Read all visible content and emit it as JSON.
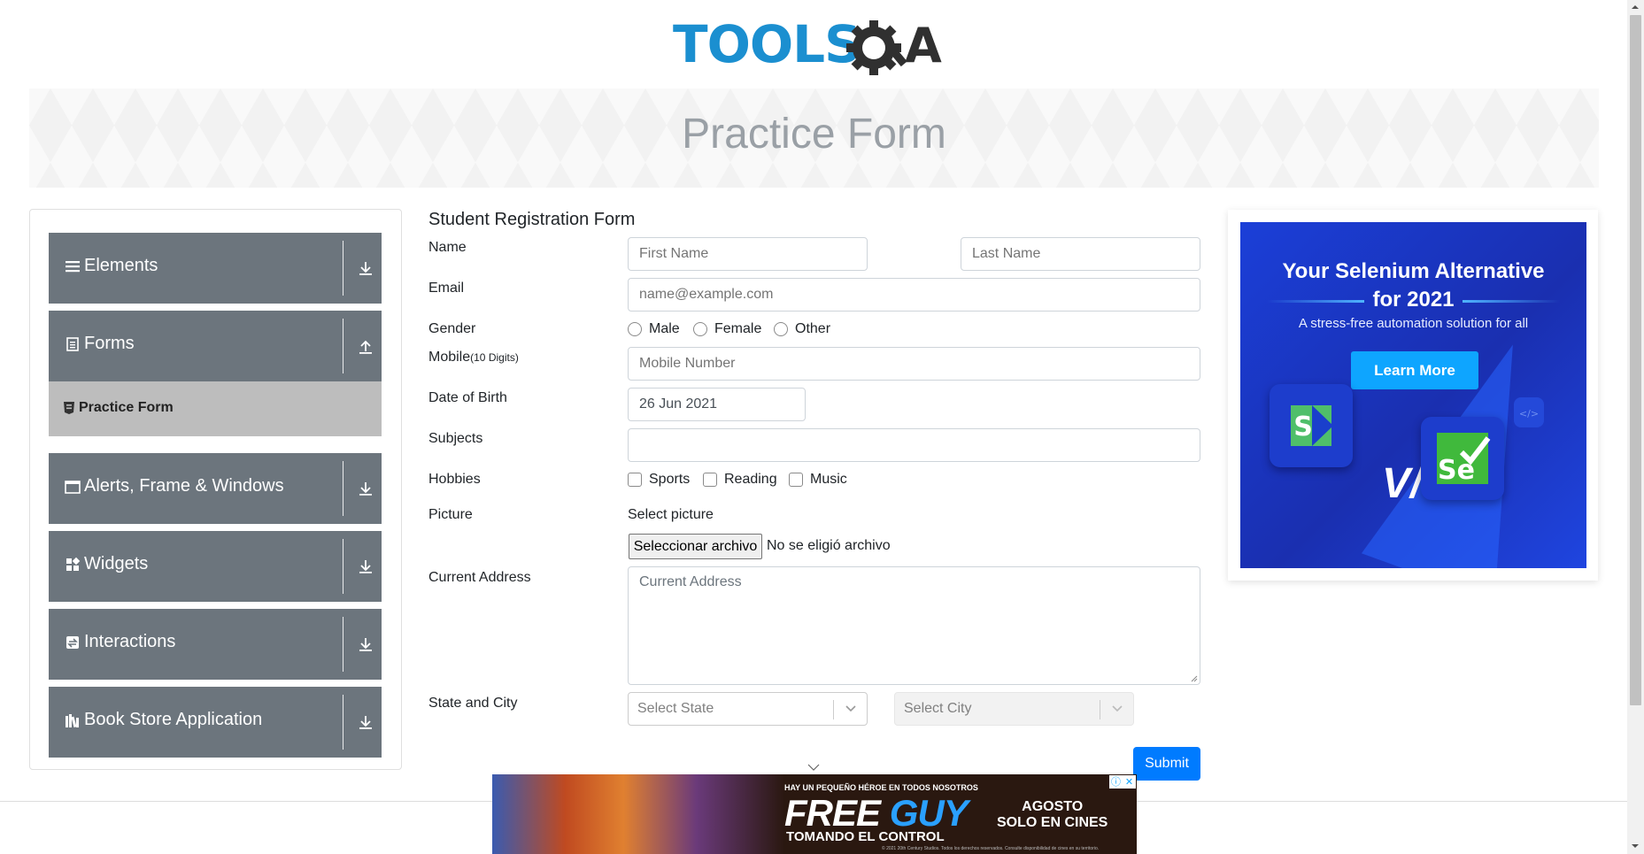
{
  "brand": {
    "logo_text_tools": "TOOLS",
    "logo_text_qa": "QA",
    "blue": "#1b8fd0",
    "dark": "#303030"
  },
  "banner": {
    "title": "Practice Form"
  },
  "sidebar": {
    "groups": [
      {
        "label": "Elements",
        "icon": "menu-icon",
        "arrow": "download-arrow"
      },
      {
        "label": "Forms",
        "icon": "document-icon",
        "arrow": "upload-arrow"
      },
      {
        "label": "Alerts, Frame & Windows",
        "icon": "window-icon",
        "arrow": "download-arrow"
      },
      {
        "label": "Widgets",
        "icon": "widgets-icon",
        "arrow": "download-arrow"
      },
      {
        "label": "Interactions",
        "icon": "interactions-icon",
        "arrow": "download-arrow"
      },
      {
        "label": "Book Store Application",
        "icon": "books-icon",
        "arrow": "download-arrow"
      }
    ],
    "sub_item": {
      "label": "Practice Form",
      "icon": "html-icon"
    },
    "group_color": "#6c757d",
    "sub_item_color": "#bdbdbd"
  },
  "form": {
    "title": "Student Registration Form",
    "labels": {
      "name": "Name",
      "email": "Email",
      "gender": "Gender",
      "mobile": "Mobile",
      "mobile_hint": "(10 Digits)",
      "dob": "Date of Birth",
      "subjects": "Subjects",
      "hobbies": "Hobbies",
      "picture": "Picture",
      "address": "Current Address",
      "state_city": "State and City"
    },
    "placeholders": {
      "first_name": "First Name",
      "last_name": "Last Name",
      "email": "name@example.com",
      "mobile": "Mobile Number",
      "address": "Current Address"
    },
    "values": {
      "dob": "26 Jun 2021",
      "subjects": ""
    },
    "gender_options": [
      "Male",
      "Female",
      "Other"
    ],
    "hobby_options": [
      "Sports",
      "Reading",
      "Music"
    ],
    "picture_hint": "Select picture",
    "file_button": "Seleccionar archivo",
    "file_status": "No se eligió archivo",
    "state_placeholder": "Select State",
    "city_placeholder": "Select City",
    "submit": "Submit",
    "submit_color": "#007bff"
  },
  "ad_right": {
    "title_line1": "Your Selenium Alternative",
    "title_line2": "for 2021",
    "subtitle": "A stress-free automation solution for all",
    "button": "Learn More",
    "vs": "V/s",
    "left_logo": "S",
    "right_logo": "Se",
    "bg_color": "#1b3fd8"
  },
  "ad_bottom": {
    "tag": "HAY UN PEQUEÑO HÉROE EN TODOS NOSOTROS",
    "title_free": "FREE",
    "title_guy": "GUY",
    "subtitle": "TOMANDO EL CONTROL",
    "right_line1": "AGOSTO",
    "right_line2": "SOLO EN CINES",
    "fine_print": "© 2021 20th Century Studios. Todos los derechos reservados. Consulte disponibilidad de cines en su territorio.",
    "close_info": "ⓘ",
    "close_x": "✕"
  }
}
